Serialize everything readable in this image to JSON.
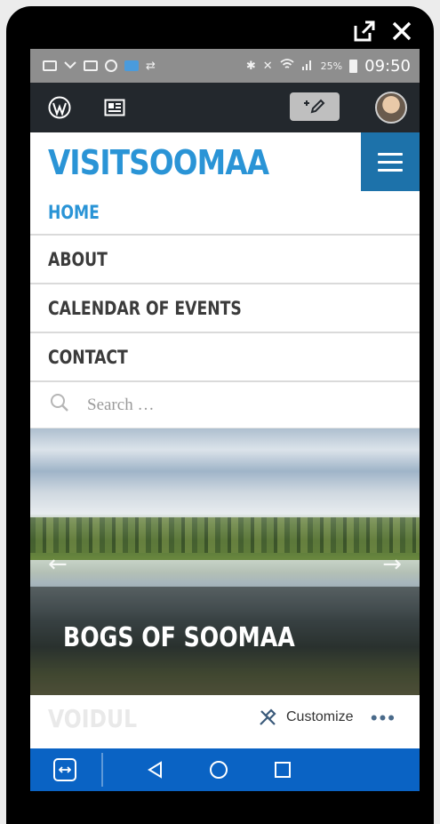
{
  "window_controls": {
    "popout_icon": "popout-icon",
    "close_icon": "close-icon"
  },
  "status_bar": {
    "battery_percent": "25%",
    "time": "09:50"
  },
  "admin_bar": {
    "wp_icon": "wordpress-icon",
    "reader_icon": "reader-icon",
    "new_post_icon": "new-post-icon",
    "avatar_icon": "avatar"
  },
  "site": {
    "title": "VISITSOOMAA"
  },
  "nav": {
    "items": [
      {
        "label": "HOME",
        "active": true
      },
      {
        "label": "ABOUT"
      },
      {
        "label": "CALENDAR OF EVENTS"
      },
      {
        "label": "CONTACT"
      }
    ]
  },
  "search": {
    "placeholder": "Search …"
  },
  "slider": {
    "title": "BOGS OF SOOMAA",
    "prev_icon": "arrow-left-icon",
    "next_icon": "arrow-right-icon"
  },
  "customize_bar": {
    "label": "Customize",
    "next_section": "VOIDUL"
  },
  "android_nav": {
    "back_icon": "back-icon",
    "home_icon": "home-icon",
    "recent_icon": "recent-apps-icon"
  },
  "colors": {
    "accent": "#2a94d6",
    "menu_toggle_bg": "#1d72aa",
    "admin_bar_bg": "#23282d",
    "android_nav_bg": "#0a63c4"
  }
}
